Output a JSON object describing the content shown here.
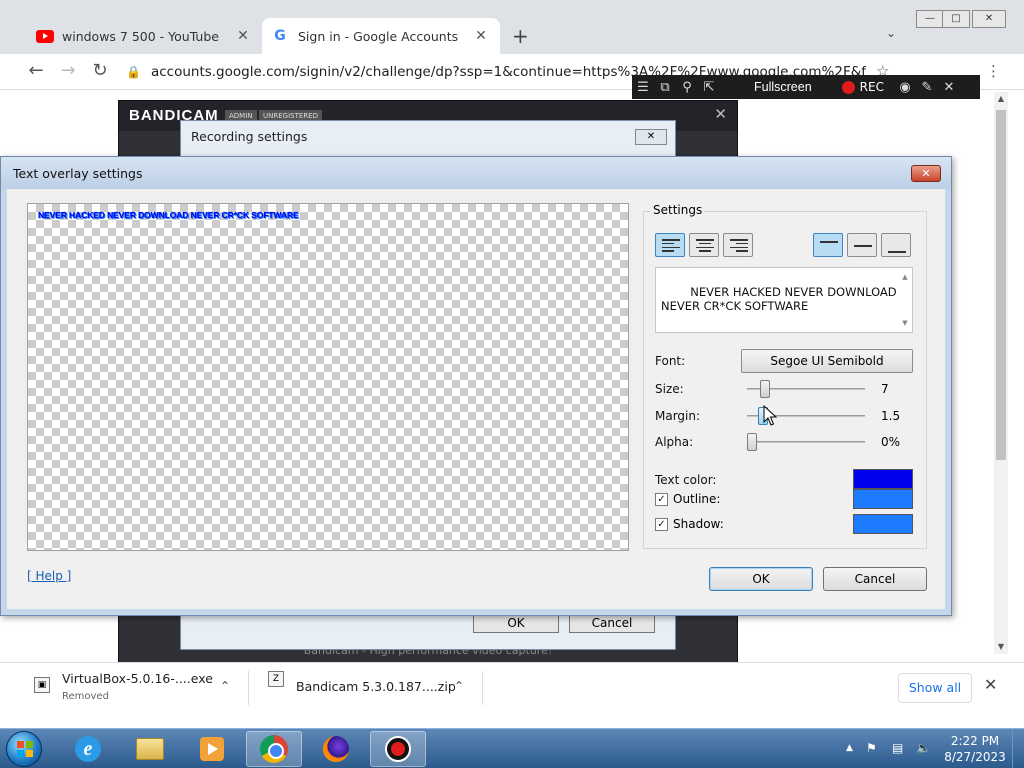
{
  "browser": {
    "tabs": [
      {
        "title": "windows 7 500 - YouTube",
        "close": "✕"
      },
      {
        "title": "Sign in - Google Accounts",
        "close": "✕"
      }
    ],
    "new_tab": "+",
    "url": "accounts.google.com/signin/v2/challenge/dp?ssp=1&continue=https%3A%2F%2Fwww.google.com%2F&fl"
  },
  "capture_bar": {
    "fullscreen_label": "Fullscreen",
    "rec_label": "REC"
  },
  "bandicam": {
    "logo": "BANDICAM",
    "tags": [
      "ADMIN",
      "UNREGISTERED"
    ],
    "footer": "Bandicam - High performance video capture!"
  },
  "recording_settings": {
    "title": "Recording settings",
    "ok_label": "OK",
    "cancel_label": "Cancel"
  },
  "overlay_dialog": {
    "title": "Text overlay settings",
    "preview_text": "NEVER HACKED NEVER DOWNLOAD NEVER CR*CK SOFTWARE",
    "settings_legend": "Settings",
    "overlay_text": "NEVER HACKED NEVER DOWNLOAD\nNEVER CR*CK SOFTWARE",
    "font_label": "Font:",
    "font_value": "Segoe UI Semibold",
    "size_label": "Size:",
    "size_value": "7",
    "size_level": 0.12,
    "margin_label": "Margin:",
    "margin_value": "1.5",
    "margin_level": 0.1,
    "alpha_label": "Alpha:",
    "alpha_value": "0%",
    "alpha_level": 0,
    "text_color_label": "Text color:",
    "text_color": "#0000ee",
    "outline_label": "Outline:",
    "outline_checked": true,
    "outline_color": "#1e7bff",
    "shadow_label": "Shadow:",
    "shadow_checked": true,
    "shadow_color": "#1e7bff",
    "help_label": "[ Help ]",
    "ok_label": "OK",
    "cancel_label": "Cancel",
    "h_align_active": "left",
    "v_align_active": "top"
  },
  "downloads": [
    {
      "name": "VirtualBox-5.0.16-....exe",
      "status": "Removed"
    },
    {
      "name": "Bandicam 5.3.0.187....zip",
      "status": ""
    }
  ],
  "downloads_show_all": "Show all",
  "taskbar": {
    "time": "2:22 PM",
    "date": "8/27/2023"
  }
}
